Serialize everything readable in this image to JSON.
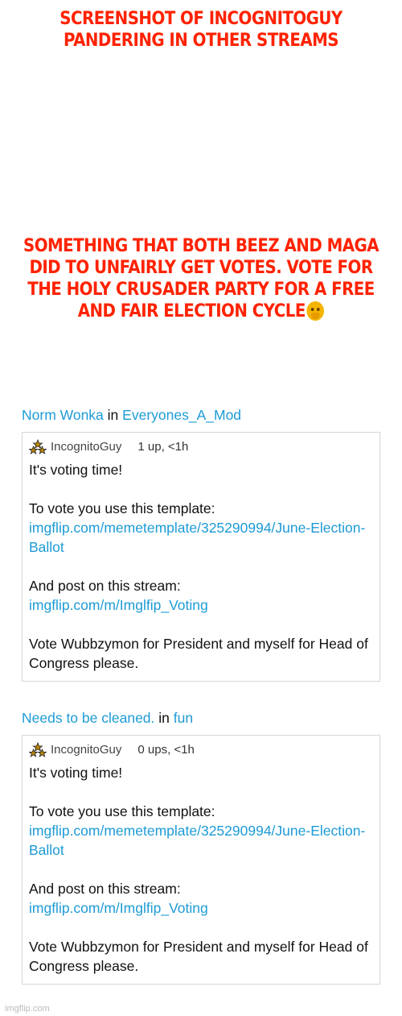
{
  "captions": {
    "top": "SCREENSHOT OF INCOGNITOGUY PANDERING IN OTHER STREAMS",
    "middle": "SOMETHING THAT BOTH BEEZ AND MAGA DID TO UNFAIRLY GET VOTES. VOTE FOR THE HOLY CRUSADER PARTY FOR A FREE AND FAIR ELECTION CYCLE",
    "emoji": "shushing-face-icon"
  },
  "comments": [
    {
      "poster": "Norm Wonka",
      "in_word": "in",
      "stream": "Everyones_A_Mod",
      "username": "IncognitoGuy",
      "meta": "1 up, <1h",
      "line1": "It's voting time!",
      "line2": "To vote you use this template:",
      "link1": "imgflip.com/memetemplate/325290994/June-Election-Ballot",
      "line3": "And post on this stream:",
      "link2": "imgflip.com/m/Imglfip_Voting",
      "line4": "Vote Wubbzymon for President and myself for Head of Congress please."
    },
    {
      "poster": "Needs to be cleaned.",
      "in_word": "in",
      "stream": "fun",
      "username": "IncognitoGuy",
      "meta": "0 ups, <1h",
      "line1": "It's voting time!",
      "line2": "To vote you use this template:",
      "link1": "imgflip.com/memetemplate/325290994/June-Election-Ballot",
      "line3": "And post on this stream:",
      "link2": "imgflip.com/m/Imglfip_Voting",
      "line4": "Vote Wubbzymon for President and myself for Head of Congress please."
    }
  ],
  "watermark": "imgflip.com",
  "colors": {
    "caption": "#ff2200",
    "link": "#1d9bd6"
  }
}
